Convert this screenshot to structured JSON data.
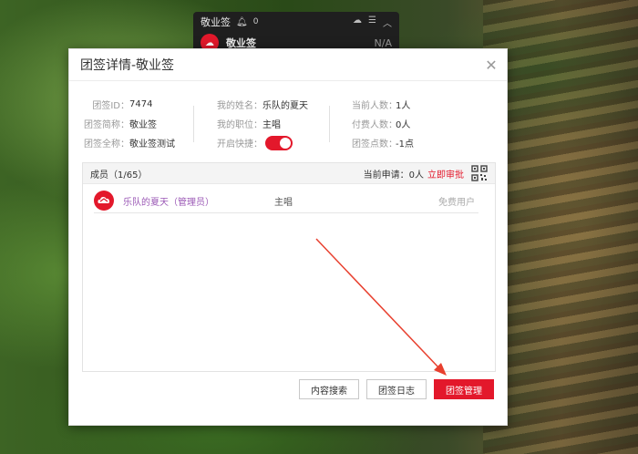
{
  "mini_widget": {
    "title": "敬业签",
    "bell_count": "0",
    "name": "敬业签",
    "na": "N/A"
  },
  "dialog": {
    "title": "团签详情-敬业签",
    "info": {
      "col1": [
        {
          "label": "团签ID：",
          "value": "7474"
        },
        {
          "label": "团签简称：",
          "value": "敬业签"
        },
        {
          "label": "团签全称：",
          "value": "敬业签测试"
        }
      ],
      "col2": [
        {
          "label": "我的姓名：",
          "value": "乐队的夏天"
        },
        {
          "label": "我的职位：",
          "value": "主唱"
        },
        {
          "label": "开启快捷：",
          "value": ""
        }
      ],
      "col3": [
        {
          "label": "当前人数：",
          "value": "1人"
        },
        {
          "label": "付费人数：",
          "value": "0人"
        },
        {
          "label": "团签点数：",
          "value": "-1点"
        }
      ]
    },
    "quick_toggle_on": true,
    "members": {
      "title": "成员（1/65）",
      "pending": "当前申请：0人",
      "approve": "立即审批",
      "rows": [
        {
          "name": "乐队的夏天（管理员）",
          "role": "主唱",
          "type": "免费用户"
        }
      ]
    },
    "buttons": {
      "search": "内容搜索",
      "log": "团签日志",
      "manage": "团签管理"
    }
  },
  "colors": {
    "accent": "#e3182b",
    "member_name": "#9b59b6"
  }
}
